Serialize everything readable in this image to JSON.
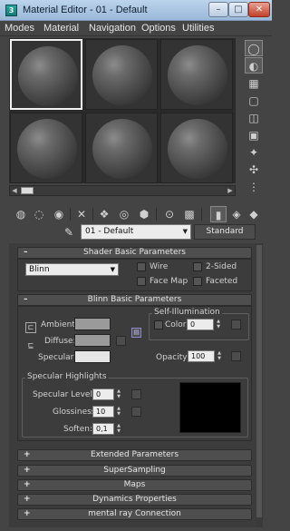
{
  "window": {
    "title": "Material Editor - 01 - Default",
    "app_icon": "3ds-max-app-icon"
  },
  "menu": [
    "Modes",
    "Material",
    "Navigation",
    "Options",
    "Utilities"
  ],
  "sample_slots": {
    "count": 9,
    "active_index": 0,
    "icon": "sphere-preview"
  },
  "right_toolbar": [
    "sample-type-icon",
    "backlight-icon",
    "background-icon",
    "tiling-icon",
    "video-check-icon",
    "make-preview-icon",
    "options-icon",
    "select-by-material-icon",
    "material-navigator-icon"
  ],
  "bottom_toolbar": [
    "get-material-icon",
    "put-to-scene-icon",
    "assign-to-selection-icon",
    "reset-map-icon",
    "copy-material-icon",
    "make-unique-icon",
    "put-to-library-icon",
    "material-id-channel-icon",
    "show-map-icon",
    "show-end-result-icon",
    "go-to-parent-icon",
    "go-forward-icon"
  ],
  "material": {
    "name": "01 - Default",
    "type": "Standard"
  },
  "shader_basic": {
    "header": "Shader Basic Parameters",
    "shader": "Blinn",
    "wire": "Wire",
    "two_sided": "2-Sided",
    "face_map": "Face Map",
    "faceted": "Faceted"
  },
  "blinn_basic": {
    "header": "Blinn Basic Parameters",
    "ambient": "Ambient:",
    "diffuse": "Diffuse:",
    "specular": "Specular:",
    "self_illum_title": "Self-Illumination",
    "color_label": "Color",
    "color_value": "0",
    "opacity_label": "Opacity:",
    "opacity_value": "100",
    "colors": {
      "ambient": "#9a9a9a",
      "diffuse": "#9a9a9a",
      "specular": "#e5e5e5",
      "highlight_curve": "#000000"
    }
  },
  "specular_highlights": {
    "title": "Specular Highlights",
    "level_label": "Specular Level:",
    "level_value": "0",
    "gloss_label": "Glossiness:",
    "gloss_value": "10",
    "soften_label": "Soften:",
    "soften_value": "0,1"
  },
  "collapsed_rollouts": [
    "Extended Parameters",
    "SuperSampling",
    "Maps",
    "Dynamics Properties",
    "mental ray Connection"
  ]
}
